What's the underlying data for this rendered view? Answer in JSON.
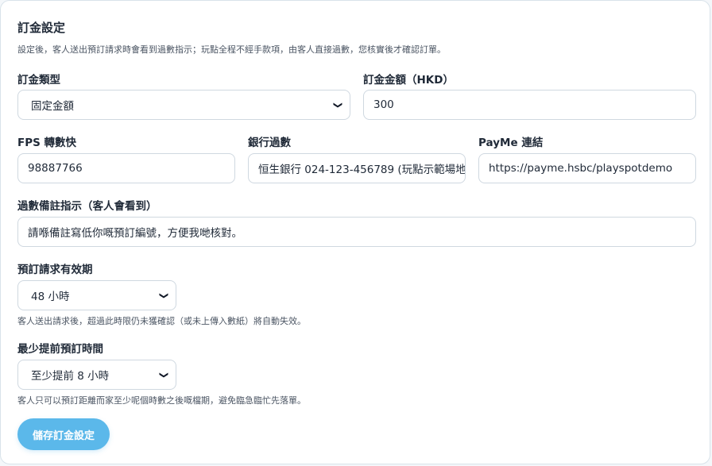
{
  "form": {
    "title": "訂金設定",
    "description": "設定後，客人送出預訂請求時會看到過數指示；玩點全程不經手款項，由客人直接過數，您核實後才確認訂單。",
    "deposit_type": {
      "label": "訂金類型",
      "value": "固定金額"
    },
    "deposit_amount": {
      "label": "訂金金額（HKD）",
      "value": "300"
    },
    "fps": {
      "label": "FPS 轉數快",
      "value": "98887766"
    },
    "bank": {
      "label": "銀行過數",
      "value": "恒生銀行 024-123-456789 (玩點示範場地"
    },
    "payme": {
      "label": "PayMe 連結",
      "value": "https://payme.hsbc/playspotdemo"
    },
    "remarks": {
      "label": "過數備註指示（客人會看到）",
      "value": "請喺備註寫低你嘅預訂編號，方便我哋核對。"
    },
    "validity": {
      "label": "預訂請求有效期",
      "value": "48 小時",
      "hint": "客人送出請求後，超過此時限仍未獲確認（或未上傳入數紙）將自動失效。"
    },
    "advance": {
      "label": "最少提前預訂時間",
      "value": "至少提前 8 小時",
      "hint": "客人只可以預訂距離而家至少呢個時數之後嘅檔期，避免臨急臨忙先落單。"
    },
    "save_label": "儲存訂金設定"
  }
}
